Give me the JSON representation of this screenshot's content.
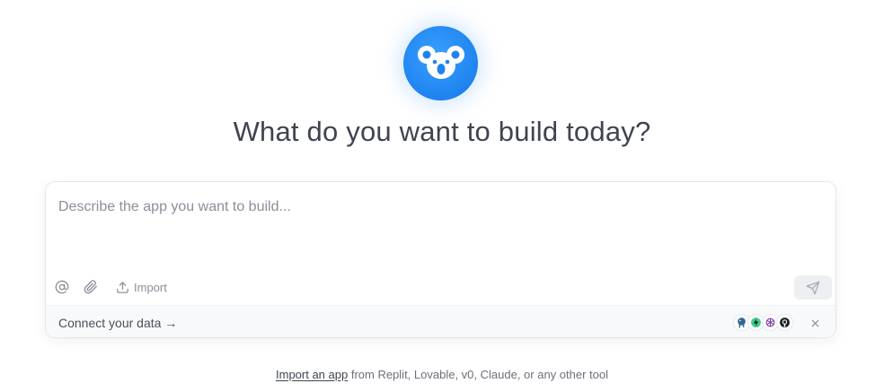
{
  "header": {
    "logo_icon": "koala-logo",
    "title": "What do you want to build today?"
  },
  "composer": {
    "placeholder": "Describe the app you want to build...",
    "value": "",
    "mention_icon": "at-sign-icon",
    "attach_icon": "paperclip-icon",
    "import_label": "Import",
    "send_icon": "send-icon"
  },
  "connect_bar": {
    "label": "Connect your data →",
    "integrations": [
      "postgresql-icon",
      "supabase-icon",
      "openai-icon",
      "github-icon"
    ],
    "close_icon": "close-icon"
  },
  "footer_note": {
    "link_text": "Import an app",
    "rest_text": " from Replit, Lovable, v0, Claude, or any other tool"
  },
  "colors": {
    "brand_blue": "#1f83ef",
    "title_text": "#3f4451",
    "muted_text": "#8a8f99"
  }
}
